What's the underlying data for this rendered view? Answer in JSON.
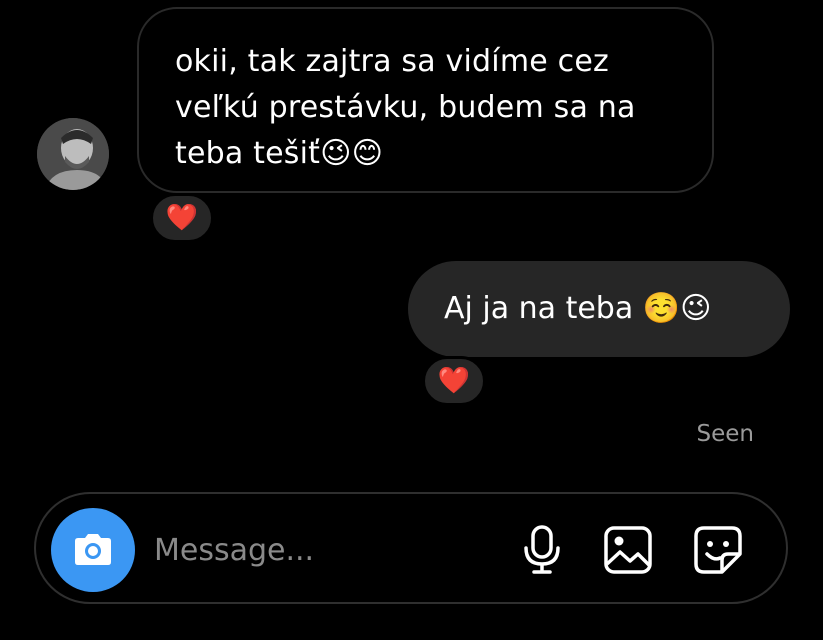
{
  "incoming": {
    "lines": [
      "okii, tak zajtra sa vidíme cez",
      "veľkú prestávku, budem sa na",
      "teba tešiť😉😊"
    ],
    "reaction": "❤️"
  },
  "outgoing": {
    "text": "Aj ja na teba ☺️😉",
    "reaction": "❤️",
    "status": "Seen"
  },
  "composer": {
    "placeholder": "Message...",
    "icons": [
      "camera-icon",
      "microphone-icon",
      "gallery-icon",
      "sticker-icon"
    ]
  },
  "colors": {
    "background": "#000000",
    "bubble": "#262626",
    "accent": "#3b97f3",
    "muted_text": "#9a9a9a",
    "heart": "#e8202a"
  }
}
